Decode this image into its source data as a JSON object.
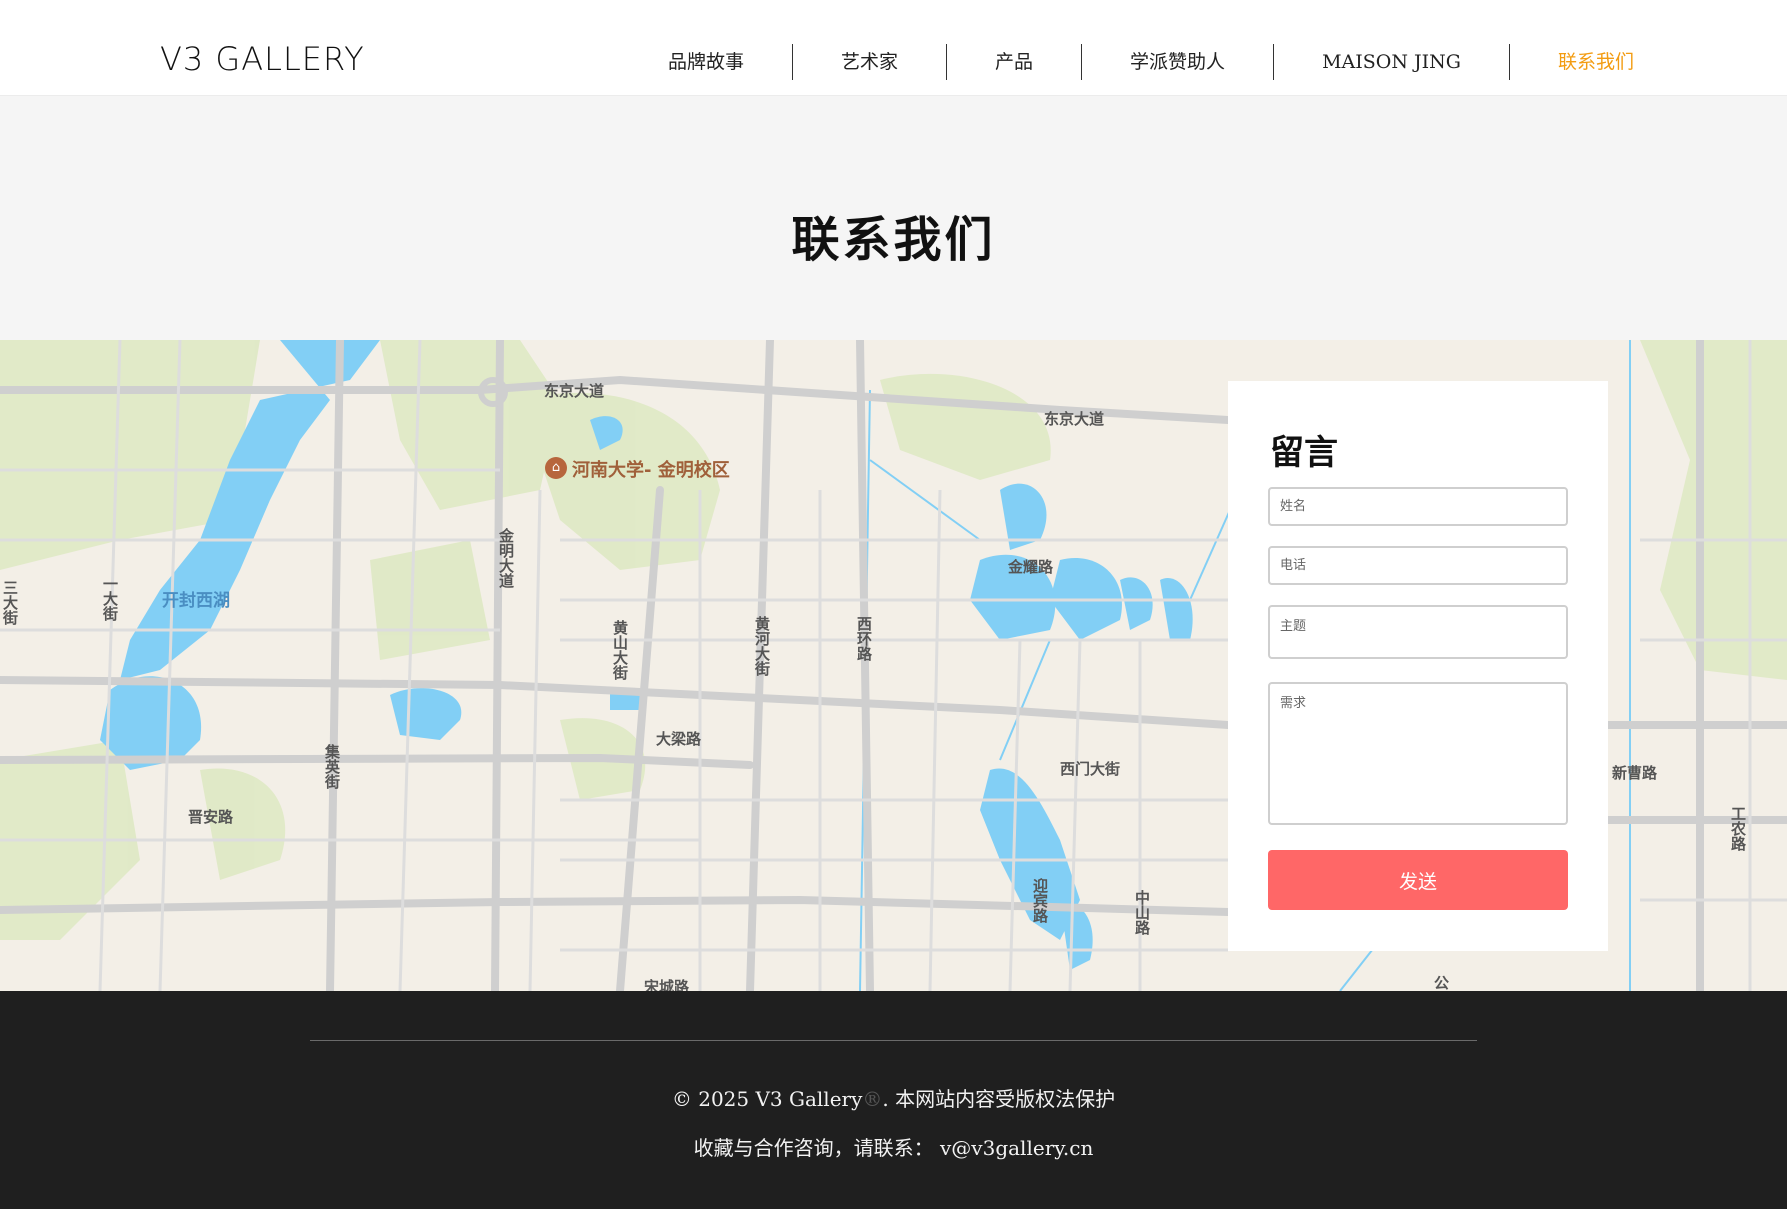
{
  "header": {
    "logo": "V3 GALLERY",
    "nav": [
      {
        "label": "品牌故事"
      },
      {
        "label": "艺术家"
      },
      {
        "label": "产品"
      },
      {
        "label": "学派赞助人"
      },
      {
        "label": "MAISON JING"
      },
      {
        "label": "联系我们",
        "active": true
      }
    ],
    "active_color": "#f39c12"
  },
  "hero": {
    "title": "联系我们"
  },
  "map": {
    "labels": {
      "dongjing_1": "东京大道",
      "dongjing_2": "东京大道",
      "henan_univ": "河南大学- 金明校区",
      "jinyao": "金耀路",
      "jinming": "金明大道",
      "yihuangshan": "黄山大街",
      "huanghe": "黄河大街",
      "xihuan": "西环路",
      "kaifeng_lake": "开封西湖",
      "yida": "一大街",
      "sanda": "三大街",
      "daliang": "大梁路",
      "jiying": "集英街",
      "jinan": "晋安路",
      "ximen": "西门大街",
      "xincao": "新曹路",
      "gongnong": "工农路",
      "songcheng": "宋城路",
      "zhongshan": "中山路",
      "yingbin": "迎宾路",
      "gong": "公"
    }
  },
  "form": {
    "title": "留言",
    "name_placeholder": "姓名",
    "phone_placeholder": "电话",
    "subject_placeholder": "主题",
    "message_placeholder": "需求",
    "submit_label": "发送",
    "button_color": "#ff6767"
  },
  "footer": {
    "copyright_prefix": "© 2025 V3 Gallery",
    "copyright_reg": "®",
    "copyright_suffix": ". 本网站内容受版权法保护",
    "contact": "收藏与合作咨询，请联系： v@v3gallery.cn"
  }
}
